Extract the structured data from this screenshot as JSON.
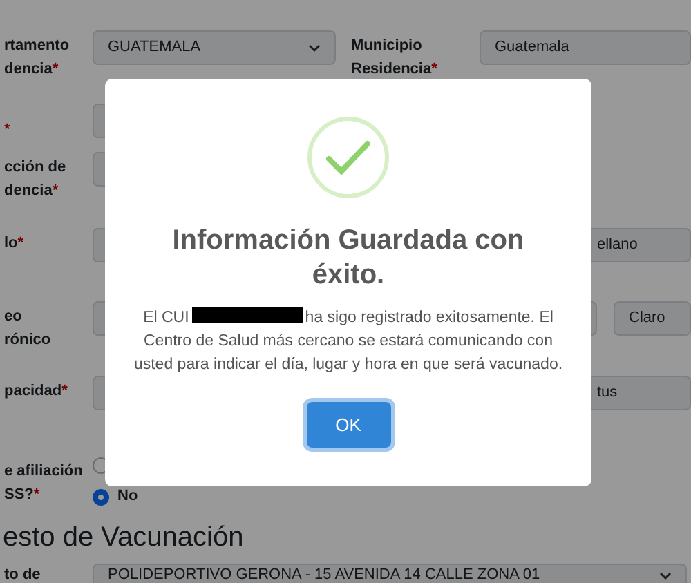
{
  "form": {
    "rows": [
      {
        "label_lines": [
          "rtamento",
          "dencia"
        ],
        "required_mark": "*",
        "field": {
          "kind": "select",
          "value": "GUATEMALA"
        },
        "right": {
          "label_lines": [
            "Municipio",
            "Residencia"
          ],
          "required_mark": "*",
          "fields": [
            {
              "kind": "wide",
              "value": "Guatemala"
            }
          ]
        }
      },
      {
        "label_lines": [],
        "required_mark": "*",
        "field": {
          "kind": "input"
        }
      },
      {
        "label_lines": [
          "cción de",
          "dencia"
        ],
        "required_mark": "*",
        "field": {
          "kind": "input"
        }
      },
      {
        "label_lines": [
          "lo"
        ],
        "required_mark": "*",
        "field": {
          "kind": "input"
        },
        "right": {
          "fields": [
            {
              "kind": "partial",
              "value": "ellano"
            }
          ]
        }
      },
      {
        "label_lines": [
          "eo",
          "rónico"
        ],
        "field": {
          "kind": "input"
        },
        "right": {
          "fields": [
            {
              "kind": "sliver"
            },
            {
              "kind": "short",
              "value": "Claro"
            }
          ]
        }
      },
      {
        "label_lines": [
          "pacidad"
        ],
        "required_mark": "*",
        "field": {
          "kind": "input"
        },
        "right": {
          "fields": [
            {
              "kind": "partial",
              "value": "tus"
            }
          ]
        }
      },
      {
        "label_lines": [
          "e afiliación",
          "SS?"
        ],
        "required_mark": "*",
        "radios": [
          {
            "selected": false
          },
          {
            "label": "No",
            "selected": true
          }
        ]
      }
    ],
    "section_heading": "esto de Vacunación",
    "bottom_row": {
      "label_lines": [
        "to de"
      ],
      "field": {
        "kind": "select",
        "value": "POLIDEPORTIVO GERONA - 15 AVENIDA 14 CALLE ZONA 01"
      }
    }
  },
  "dialog": {
    "title": "Información Guardada con éxito.",
    "message_start": "El CUI",
    "message_rest": "ha sigo registrado exitosamente. El Centro de Salud más cercano se estará comunicando con usted para indicar el día, lugar y hora en que será vacunado.",
    "button": "OK"
  }
}
